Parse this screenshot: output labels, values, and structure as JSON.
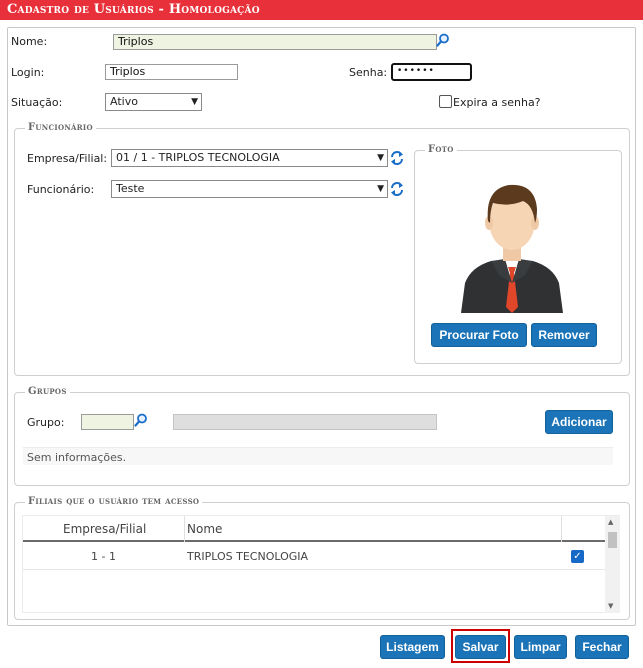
{
  "title": "Cadastro de Usuários  - Homologação",
  "form": {
    "nome_label": "Nome:",
    "nome_value": "Triplos",
    "login_label": "Login:",
    "login_value": "Triplos",
    "senha_label": "Senha:",
    "senha_value": "••••••",
    "situacao_label": "Situação:",
    "situacao_value": "Ativo",
    "expira_label": "Expira a senha?"
  },
  "funcionario": {
    "legend": "Funcionário",
    "empresa_label": "Empresa/Filial:",
    "empresa_value": "01 / 1 - TRIPLOS TECNOLOGIA",
    "func_label": "Funcionário:",
    "func_value": "Teste"
  },
  "foto": {
    "legend": "Foto",
    "procurar_label": "Procurar Foto",
    "remover_label": "Remover"
  },
  "grupos": {
    "legend": "Grupos",
    "grupo_label": "Grupo:",
    "adicionar_label": "Adicionar",
    "empty_text": "Sem informações."
  },
  "filiais": {
    "legend": "Filiais que o usuário tem acesso",
    "columns": [
      "Empresa/Filial",
      "Nome"
    ],
    "rows": [
      {
        "empresa": "1 - 1",
        "nome": "TRIPLOS TECNOLOGIA",
        "checked": true
      }
    ]
  },
  "footer": {
    "listagem_label": "Listagem",
    "salvar_label": "Salvar",
    "limpar_label": "Limpar",
    "fechar_label": "Fechar"
  },
  "colors": {
    "titlebar": "#e8303a",
    "button": "#1b74b8",
    "highlight_border": "#cc0000"
  },
  "icons": [
    "search-icon",
    "refresh-icon",
    "chevron-down-icon",
    "checkmark-icon",
    "avatar-placeholder"
  ]
}
